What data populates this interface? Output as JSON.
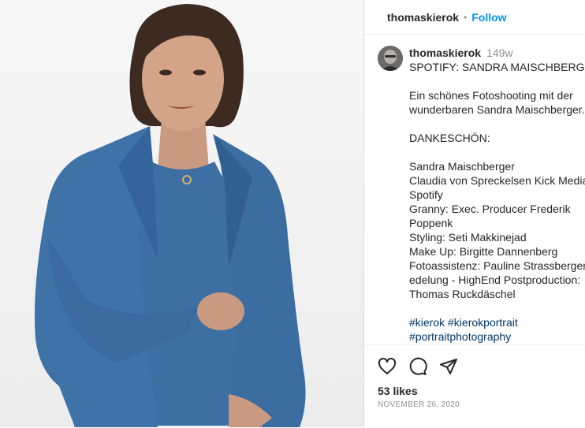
{
  "header": {
    "username": "thomaskierok",
    "separator": "•",
    "follow_label": "Follow"
  },
  "caption": {
    "username": "thomaskierok",
    "time": "149w",
    "lines": [
      "SPOTIFY: SANDRA MAISCHBERGER",
      "",
      "Ein schönes Fotoshooting mit der",
      "wunderbaren Sandra Maischberger.",
      "",
      "DANKESCHÖN:",
      "",
      "Sandra Maischberger",
      "Claudia von Spreckelsen Kick Media",
      "Spotify",
      "Granny: Exec. Producer Frederik",
      "Poppenk",
      "Styling: Seti Makkinejad",
      "Make Up: Birgitte Dannenberg",
      "Fotoassistenz: Pauline Strassberger",
      "edelung - HighEnd Postproduction:",
      "Thomas Ruckdäschel",
      ""
    ],
    "hashtags_line1": "#kierok #kierokportrait",
    "hashtags_line2": "#portraitphotography"
  },
  "actions": {
    "icons": [
      "heart-icon",
      "comment-icon",
      "share-icon"
    ],
    "likes": "53 likes",
    "date": "NOVEMBER 26, 2020"
  },
  "colors": {
    "accent": "#0095f6",
    "hashtag": "#00376b",
    "muted": "#8e8e8e",
    "suit": "#3f73a8"
  }
}
